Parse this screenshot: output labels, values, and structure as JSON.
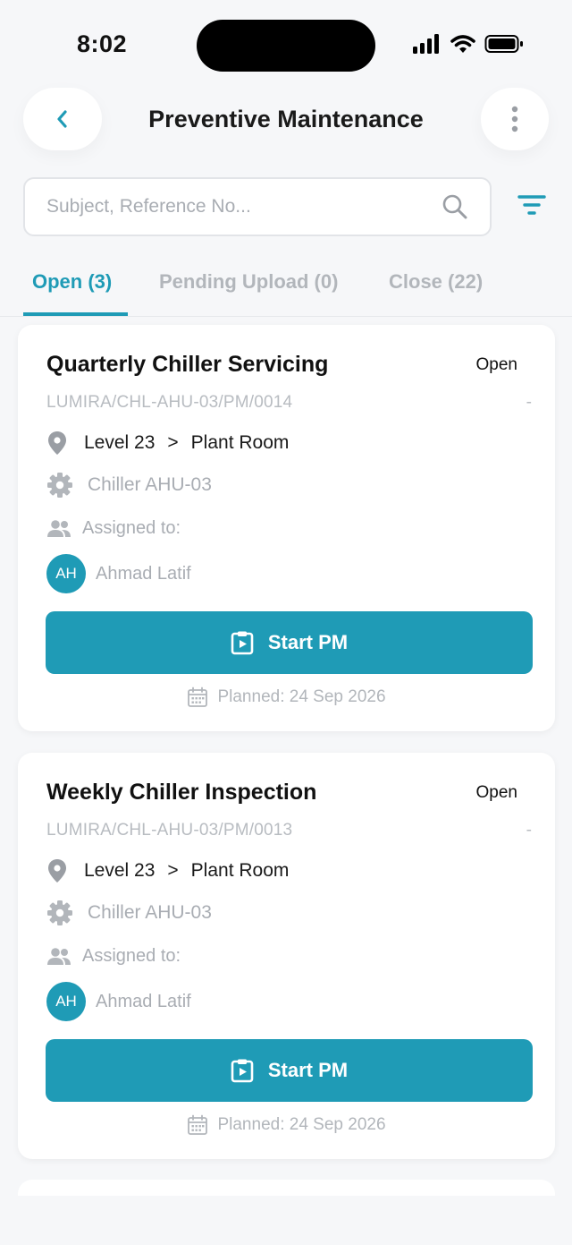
{
  "status_bar": {
    "time": "8:02"
  },
  "header": {
    "title": "Preventive Maintenance"
  },
  "search": {
    "placeholder": "Subject, Reference No..."
  },
  "tabs": [
    {
      "label": "Open (3)",
      "active": true
    },
    {
      "label": "Pending Upload (0)",
      "active": false
    },
    {
      "label": "Close (22)",
      "active": false
    }
  ],
  "cards": [
    {
      "title": "Quarterly Chiller Servicing",
      "status": "Open",
      "reference": "LUMIRA/CHL-AHU-03/PM/0014",
      "dash": "-",
      "location_level": "Level 23",
      "location_separator": ">",
      "location_room": "Plant Room",
      "asset": "Chiller AHU-03",
      "assigned_label": "Assigned to:",
      "assignee_initials": "AH",
      "assignee_name": "Ahmad Latif",
      "action_label": "Start PM",
      "planned": "Planned: 24 Sep 2026"
    },
    {
      "title": "Weekly Chiller Inspection",
      "status": "Open",
      "reference": "LUMIRA/CHL-AHU-03/PM/0013",
      "dash": "-",
      "location_level": "Level 23",
      "location_separator": ">",
      "location_room": "Plant Room",
      "asset": "Chiller AHU-03",
      "assigned_label": "Assigned to:",
      "assignee_initials": "AH",
      "assignee_name": "Ahmad Latif",
      "action_label": "Start PM",
      "planned": "Planned: 24 Sep 2026"
    }
  ],
  "colors": {
    "accent": "#1f9bb6",
    "muted_text": "#a9adb3",
    "background": "#f6f7f9"
  },
  "icons": [
    "back-chevron-icon",
    "more-vertical-icon",
    "search-icon",
    "filter-icon",
    "location-pin-icon",
    "gear-icon",
    "people-icon",
    "clipboard-play-icon",
    "calendar-icon"
  ]
}
